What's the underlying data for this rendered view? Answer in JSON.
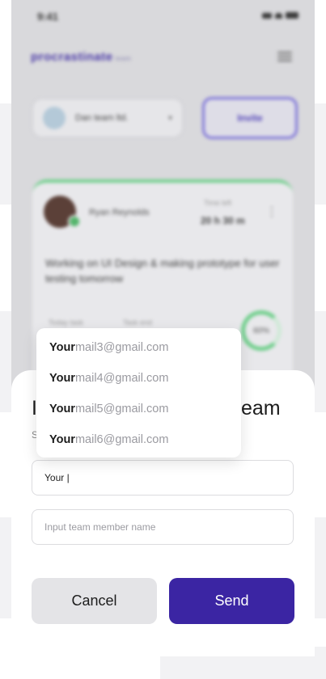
{
  "background_app": {
    "status_time": "9:41",
    "logo": "procrastinate",
    "logo_tag": "team",
    "team_selector_label": "Dan team ltd.",
    "invite_label": "Invite",
    "card": {
      "user": "Ryan Reynolds",
      "time_label": "Time left",
      "time_value": "20 h 30 m",
      "description": "Working on UI Design & making prototype for user testing tomorrow",
      "meta_1": "Today task",
      "meta_2": "Task end",
      "progress": "60%"
    }
  },
  "sheet": {
    "title_left": "I",
    "title_right": "eam",
    "subtitle_fragment": "S",
    "email_value": "Your |",
    "name_placeholder": "Input team member name",
    "cancel_label": "Cancel",
    "send_label": "Send"
  },
  "suggestions": [
    {
      "match": "Your",
      "rest": "mail3@gmail.com"
    },
    {
      "match": "Your",
      "rest": "mail4@gmail.com"
    },
    {
      "match": "Your",
      "rest": "mail5@gmail.com"
    },
    {
      "match": "Your",
      "rest": "mail6@gmail.com"
    }
  ],
  "colors": {
    "accent": "#3b25a3",
    "overlay_bg": "#d9d9dc",
    "progress_green": "#6fcf8b"
  }
}
